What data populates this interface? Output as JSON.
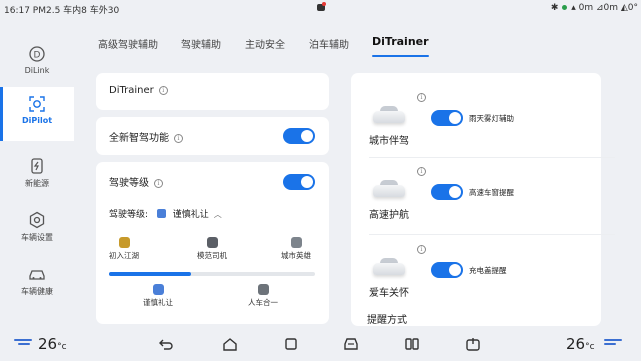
{
  "status": {
    "left_text": "16:17 PM2.5 车内8 车外30",
    "right_text": "0m ⊿0m ◭0°"
  },
  "sidebar": {
    "items": [
      {
        "label": "DiLink",
        "icon": "dilink-icon"
      },
      {
        "label": "DiPilot",
        "icon": "dipilot-icon",
        "active": true
      },
      {
        "label": "新能源",
        "icon": "battery-icon"
      },
      {
        "label": "车辆设置",
        "icon": "car-settings-icon"
      },
      {
        "label": "车辆健康",
        "icon": "car-health-icon"
      }
    ]
  },
  "tabs": [
    {
      "label": "高级驾驶辅助"
    },
    {
      "label": "驾驶辅助"
    },
    {
      "label": "主动安全"
    },
    {
      "label": "泊车辅助"
    },
    {
      "label": "DiTrainer",
      "active": true
    }
  ],
  "left": {
    "ditrainer_title": "DiTrainer",
    "smart_drive_label": "全新智驾功能",
    "level_title": "驾驶等级",
    "level_current_prefix": "驾驶等级:",
    "level_current_value": "谨慎礼让",
    "levels": [
      "初入江湖",
      "模范司机",
      "城市英雄"
    ],
    "levels_bottom": [
      "谨慎礼让",
      "人车合一"
    ],
    "progress": 0.4
  },
  "right": {
    "features": [
      {
        "name": "城市伴驾",
        "toggle_label": "雨天雾灯辅助"
      },
      {
        "name": "高速护航",
        "toggle_label": "高速车窗提醒"
      },
      {
        "name": "爱车关怀",
        "toggle_label": "充电盖提醒"
      }
    ],
    "reminder_label": "提醒方式"
  },
  "bottombar": {
    "temp_left": "26",
    "temp_right": "26",
    "unit": "°c"
  },
  "colors": {
    "accent": "#1a73e8",
    "background": "#eef0f4",
    "card": "#ffffff"
  }
}
